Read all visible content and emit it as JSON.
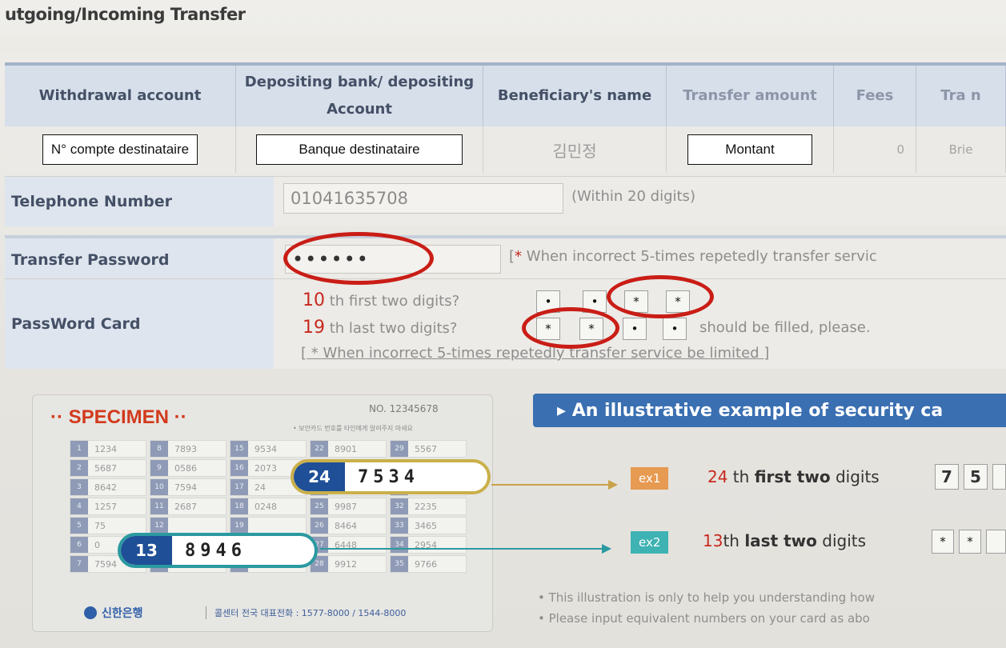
{
  "page": {
    "title": "utgoing/Incoming Transfer"
  },
  "table": {
    "headers": [
      {
        "label": "Withdrawal account"
      },
      {
        "label": "Depositing bank/ depositing Account"
      },
      {
        "label": "Beneficiary's name"
      },
      {
        "label": "Transfer amount"
      },
      {
        "label": "Fees"
      },
      {
        "label": "Tra n"
      }
    ],
    "row": {
      "withdrawal_account": "N° compte destinataire",
      "depositing_bank": "Banque destinataire",
      "beneficiary_name": "김민정",
      "transfer_amount": "Montant",
      "fees": "0",
      "last": "Brie"
    }
  },
  "telephone": {
    "label": "Telephone Number",
    "value": "01041635708",
    "hint": "(Within 20 digits)"
  },
  "transfer_password": {
    "label": "Transfer Password",
    "value": "••••••",
    "hint_prefix": "[",
    "hint_star": "*",
    "hint": "When incorrect 5-times repetedly transfer servic"
  },
  "password_card": {
    "label": "PassWord Card",
    "line1_num": "10",
    "line1_text": "th first two digits?",
    "line2_num": "19",
    "line2_text": "th last two digits?",
    "fill_hint": "should be filled, please.",
    "warning": "[ * When incorrect 5-times repetedly transfer service be limited ]",
    "dots": [
      "•",
      "•",
      "*",
      "*",
      "*",
      "*",
      "•",
      "•"
    ]
  },
  "card": {
    "specimen": "·· SPECIMEN ··",
    "card_no": "NO. 12345678",
    "small_text": "• 보안카드 번호를 타인에게 알려주지 마세요",
    "cells": [
      [
        "1",
        "1234"
      ],
      [
        "8",
        "7893"
      ],
      [
        "15",
        "9534"
      ],
      [
        "22",
        "8901"
      ],
      [
        "29",
        "5567"
      ],
      [
        "2",
        "5687"
      ],
      [
        "9",
        "0586"
      ],
      [
        "16",
        "2073"
      ],
      [
        "23",
        ""
      ],
      [
        "30",
        ""
      ],
      [
        "3",
        "8642"
      ],
      [
        "10",
        "7594"
      ],
      [
        "17",
        "24"
      ],
      [
        "24",
        ""
      ],
      [
        "31",
        ""
      ],
      [
        "4",
        "1257"
      ],
      [
        "11",
        "2687"
      ],
      [
        "18",
        "0248"
      ],
      [
        "25",
        "9987"
      ],
      [
        "32",
        "2235"
      ],
      [
        "5",
        "75"
      ],
      [
        "12",
        ""
      ],
      [
        "19",
        ""
      ],
      [
        "26",
        "8464"
      ],
      [
        "33",
        "3465"
      ],
      [
        "6",
        "0"
      ],
      [
        "13",
        ""
      ],
      [
        "20",
        ""
      ],
      [
        "27",
        "6448"
      ],
      [
        "34",
        "2954"
      ],
      [
        "7",
        "7594"
      ],
      [
        "14",
        "2046"
      ],
      [
        "21",
        "6713"
      ],
      [
        "28",
        "9912"
      ],
      [
        "35",
        "9766"
      ]
    ],
    "zoom1_num": "24",
    "zoom1_val": "7534",
    "zoom2_num": "13",
    "zoom2_val": "8946",
    "bank_logo": "신한은행",
    "bank_phone": "콜센터 전국 대표전화 : 1577-8000 / 1544-8000"
  },
  "example": {
    "banner": "▸ An illustrative example of security ca",
    "ex1_tag": "ex1",
    "ex1_num": "24",
    "ex1_text_a": " th ",
    "ex1_text_b": "first two",
    "ex1_text_c": " digits",
    "ex1_d1": "7",
    "ex1_d2": "5",
    "ex2_tag": "ex2",
    "ex2_num": "13",
    "ex2_text_a": "th ",
    "ex2_text_b": "last two",
    "ex2_text_c": " digits",
    "ex2_d1": "*",
    "ex2_d2": "*",
    "note1": "• This illustration is only to help you understanding how",
    "note2": "• Please input equivalent numbers on your card as abo"
  },
  "colors": {
    "header_bg": "#d7dfea",
    "header_text": "#445066",
    "annotation_red": "#c91d16",
    "banner_blue": "#3a6fb1"
  }
}
